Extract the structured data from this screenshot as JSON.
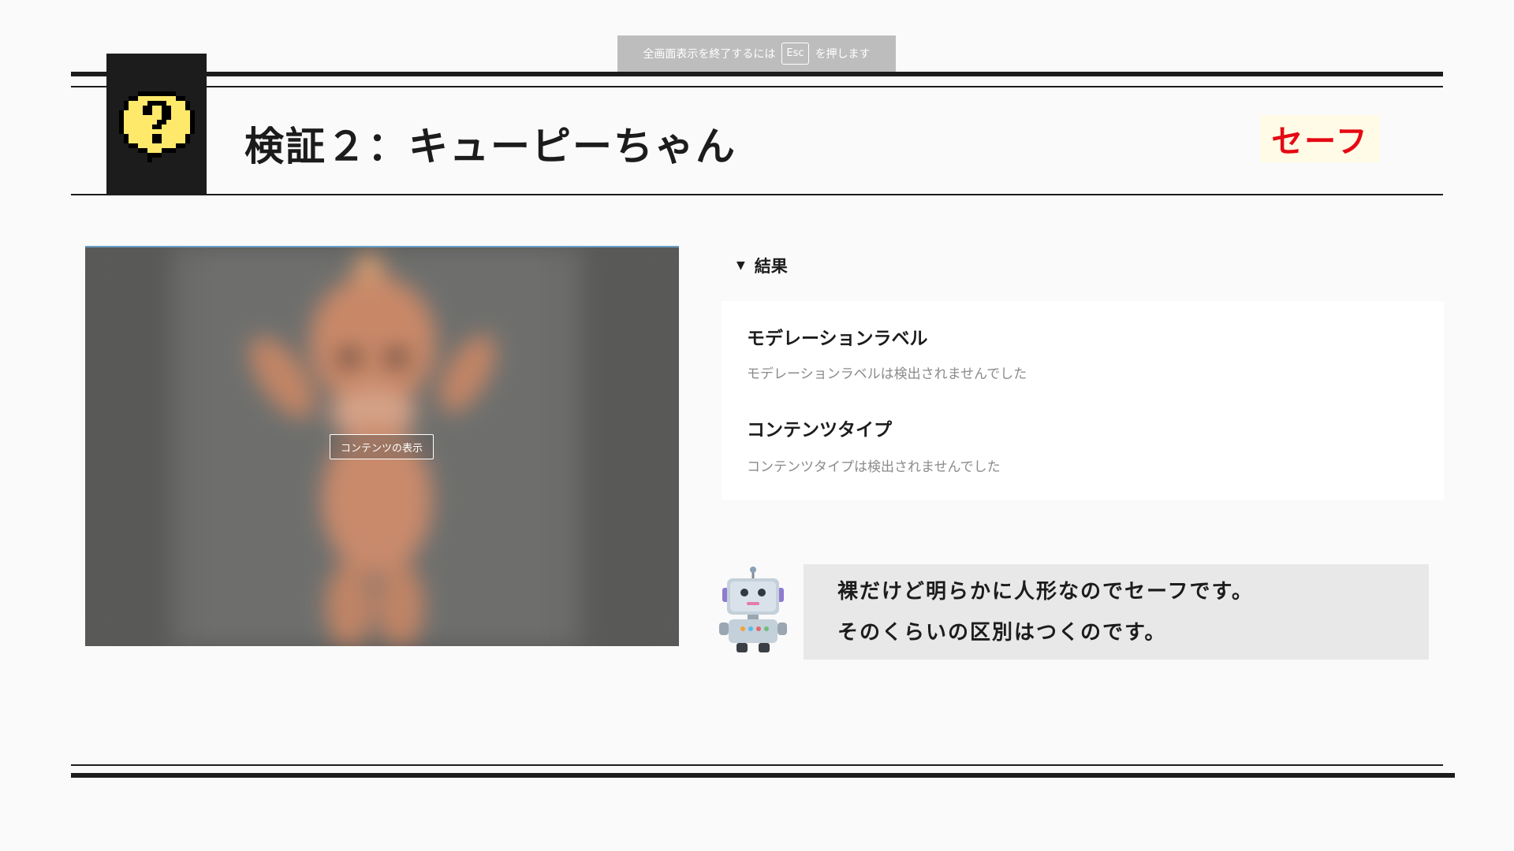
{
  "fullscreen_notice": {
    "before": "全画面表示を終了するには",
    "key": "Esc",
    "after": "を押します"
  },
  "header": {
    "title": "検証２：キューピーちゃん",
    "badge": "セーフ",
    "icon": "question-bubble-icon"
  },
  "media": {
    "show_button_label": "コンテンツの表示"
  },
  "results": {
    "toggle_label": "結果",
    "sections": [
      {
        "heading": "モデレーションラベル",
        "text": "モデレーションラベルは検出されませんでした"
      },
      {
        "heading": "コンテンツタイプ",
        "text": "コンテンツタイプは検出されませんでした"
      }
    ]
  },
  "comment": {
    "avatar": "robot-icon",
    "lines": [
      "裸だけど明らかに人形なのでセーフです。",
      "そのくらいの区別はつくのです。"
    ]
  },
  "colors": {
    "ink": "#1c1c1c",
    "badge_text": "#e50914",
    "badge_bg": "#fffbe6",
    "question_yellow": "#ffe96b"
  }
}
